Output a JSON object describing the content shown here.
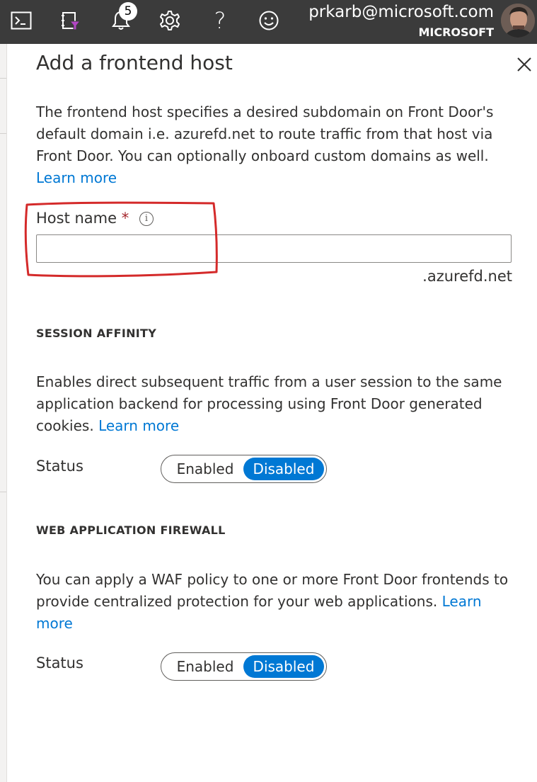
{
  "topbar": {
    "icons": [
      "cloud-shell-icon",
      "directory-filter-icon",
      "notifications-icon",
      "settings-icon",
      "help-icon",
      "feedback-icon"
    ],
    "help_glyph": "?",
    "notification_count": "5",
    "user_email": "prkarb@microsoft.com",
    "user_org": "MICROSOFT"
  },
  "panel": {
    "title": "Add a frontend host",
    "intro_text": "The frontend host specifies a desired subdomain on Front Door's default domain i.e. azurefd.net to route traffic from that host via Front Door. You can optionally onboard custom domains as well.",
    "intro_link": "Learn more",
    "host_name": {
      "label": "Host name",
      "required_marker": "*",
      "info_glyph": "i",
      "value": "",
      "suffix": ".azurefd.net"
    },
    "session_affinity": {
      "heading": "SESSION AFFINITY",
      "text": "Enables direct subsequent traffic from a user session to the same application backend for processing using Front Door generated cookies.",
      "link": "Learn more",
      "status_label": "Status",
      "options": [
        "Enabled",
        "Disabled"
      ],
      "selected": "Disabled"
    },
    "waf": {
      "heading": "WEB APPLICATION FIREWALL",
      "text": "You can apply a WAF policy to one or more Front Door frontends to provide centralized protection for your web applications.",
      "link": "Learn more",
      "status_label": "Status",
      "options": [
        "Enabled",
        "Disabled"
      ],
      "selected": "Disabled"
    }
  },
  "colors": {
    "topbar": "#3b3b3b",
    "accent": "#0078d4",
    "annotation": "#d42a2a",
    "required": "#a4262c"
  }
}
